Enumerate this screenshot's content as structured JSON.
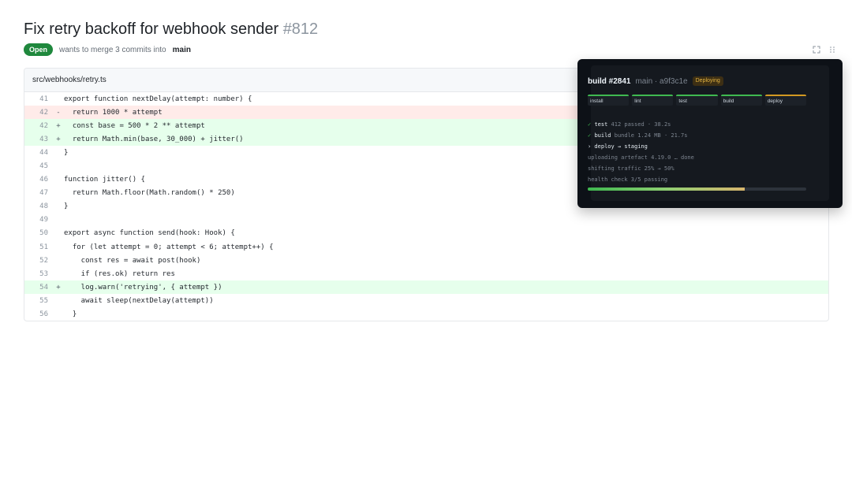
{
  "pr": {
    "title": "Fix retry backoff for webhook sender",
    "number": "#812",
    "state": "Open",
    "meta_text": "wants to merge 3 commits into",
    "base_branch": "main"
  },
  "diff": {
    "file_path": "src/webhooks/retry.ts",
    "lines": [
      {
        "n": "41",
        "sign": "",
        "text": "export function nextDelay(attempt: number) {",
        "kind": "normal"
      },
      {
        "n": "42",
        "sign": "-",
        "text": "  return 1000 * attempt",
        "kind": "del"
      },
      {
        "n": "42",
        "sign": "+",
        "text": "  const base = 500 * 2 ** attempt",
        "kind": "add"
      },
      {
        "n": "43",
        "sign": "+",
        "text": "  return Math.min(base, 30_000) + jitter()",
        "kind": "add"
      },
      {
        "n": "44",
        "sign": "",
        "text": "}",
        "kind": "normal"
      },
      {
        "n": "45",
        "sign": "",
        "text": "",
        "kind": "normal"
      },
      {
        "n": "46",
        "sign": "",
        "text": "function jitter() {",
        "kind": "normal"
      },
      {
        "n": "47",
        "sign": "",
        "text": "  return Math.floor(Math.random() * 250)",
        "kind": "normal"
      },
      {
        "n": "48",
        "sign": "",
        "text": "}",
        "kind": "normal"
      },
      {
        "n": "49",
        "sign": "",
        "text": "",
        "kind": "normal"
      },
      {
        "n": "50",
        "sign": "",
        "text": "export async function send(hook: Hook) {",
        "kind": "normal"
      },
      {
        "n": "51",
        "sign": "",
        "text": "  for (let attempt = 0; attempt < 6; attempt++) {",
        "kind": "normal"
      },
      {
        "n": "52",
        "sign": "",
        "text": "    const res = await post(hook)",
        "kind": "normal"
      },
      {
        "n": "53",
        "sign": "",
        "text": "    if (res.ok) return res",
        "kind": "normal"
      },
      {
        "n": "54",
        "sign": "+",
        "text": "    log.warn('retrying', { attempt })",
        "kind": "add"
      },
      {
        "n": "55",
        "sign": "",
        "text": "    await sleep(nextDelay(attempt))",
        "kind": "normal"
      },
      {
        "n": "56",
        "sign": "",
        "text": "  }",
        "kind": "normal"
      }
    ]
  },
  "build": {
    "id": "build #2841",
    "branch_commit": "main · a9f3c1e",
    "status": "Deploying",
    "stages": [
      {
        "label": "install",
        "state": "done"
      },
      {
        "label": "lint",
        "state": "done"
      },
      {
        "label": "test",
        "state": "done"
      },
      {
        "label": "build",
        "state": "done"
      },
      {
        "label": "deploy",
        "state": "active"
      }
    ],
    "logs": {
      "test_check": "✓",
      "test_name": "test",
      "test_detail": "412 passed · 38.2s",
      "build_check": "✓",
      "build_name": "build",
      "build_detail": "bundle 1.24 MB · 21.7s",
      "deploy_line": "› deploy → staging",
      "upload": "uploading artefact 4.19.0 … done",
      "shifting": "shifting traffic 25% → 50%",
      "health": "health check 3/5 passing"
    },
    "progress_percent": 72
  },
  "icons": {
    "expand": "expand-icon",
    "grid": "grid-icon"
  },
  "colors": {
    "open_green": "#1f883d",
    "deploy_yellow": "#d29922",
    "success_green": "#3fb950"
  }
}
